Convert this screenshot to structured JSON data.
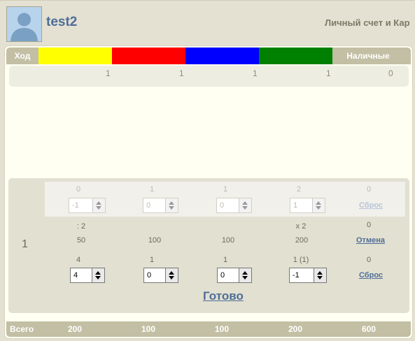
{
  "header": {
    "username": "test2",
    "account_title": "Личный счет и Кар"
  },
  "table": {
    "turn_label": "Ход",
    "cash_label": "Наличные",
    "colors": [
      "#ffff00",
      "#ff0000",
      "#0000ff",
      "#008000"
    ],
    "top_totals": [
      "1",
      "1",
      "1",
      "1",
      "0"
    ],
    "row_number": "1",
    "prev_values": [
      "0",
      "1",
      "1",
      "2",
      "0"
    ],
    "prev_inputs": [
      "-1",
      "0",
      "0",
      "1"
    ],
    "prev_reset": "Сброс",
    "ops": [
      ": 2",
      "",
      "",
      "x 2",
      "0"
    ],
    "amounts": [
      "50",
      "100",
      "100",
      "200"
    ],
    "cancel": "Отмена",
    "cur_values": [
      "4",
      "1",
      "1",
      "1 (1)",
      "0"
    ],
    "cur_inputs": [
      "4",
      "0",
      "0",
      "-1"
    ],
    "cur_reset": "Сброс",
    "done": "Готово",
    "footer_label": "Всего",
    "footer_totals": [
      "200",
      "100",
      "100",
      "200",
      "600"
    ]
  }
}
